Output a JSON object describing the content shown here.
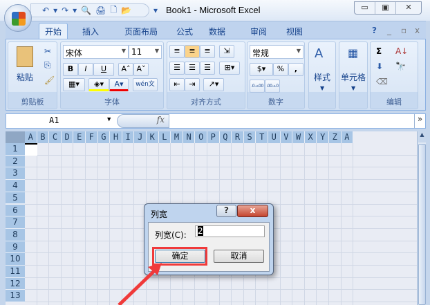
{
  "window": {
    "title": "Book1 - Microsoft Excel",
    "controls": [
      "▭",
      "▣",
      "✕"
    ]
  },
  "qat": {
    "icons": [
      "↶",
      "▾",
      "↷",
      "▾",
      "🔍",
      "🖨",
      "🗋",
      "📂"
    ],
    "customize": "▾"
  },
  "tabs": [
    "开始",
    "插入",
    "页面布局",
    "公式",
    "数据",
    "审阅",
    "视图"
  ],
  "ribbon_right": {
    "help": "?",
    "min": "_",
    "restore": "▫",
    "close": "x"
  },
  "ribbon": {
    "clipboard": {
      "label": "剪贴板",
      "paste": "粘贴"
    },
    "font": {
      "label": "字体",
      "font_name": "宋体",
      "font_size": "11",
      "bold": "B",
      "italic": "I",
      "underline": "U",
      "grow": "A˄",
      "shrink": "A˅",
      "wen": "wén文"
    },
    "alignment": {
      "label": "对齐方式"
    },
    "number": {
      "label": "数字",
      "format": "常规",
      "percent": "%",
      "comma": ",",
      "inc": ".0→.00",
      "dec": ".00→.0"
    },
    "styles": {
      "label": "样式"
    },
    "cells": {
      "label": "单元格"
    },
    "editing": {
      "label": "编辑",
      "sum": "Σ"
    }
  },
  "formula_bar": {
    "name_box": "A1",
    "fx": "fx",
    "value": ""
  },
  "sheet": {
    "columns": [
      "A",
      "B",
      "C",
      "D",
      "E",
      "F",
      "G",
      "H",
      "I",
      "J",
      "K",
      "L",
      "M",
      "N",
      "O",
      "P",
      "Q",
      "R",
      "S",
      "T",
      "U",
      "V",
      "W",
      "X",
      "Y",
      "Z",
      "A"
    ],
    "rows": [
      "1",
      "2",
      "3",
      "4",
      "5",
      "6",
      "7",
      "8",
      "9",
      "10",
      "11",
      "12",
      "13"
    ]
  },
  "dialog": {
    "title": "列宽",
    "help": "?",
    "close": "x",
    "label": "列宽(C):",
    "value": "2",
    "ok": "确定",
    "cancel": "取消"
  },
  "colors": {
    "highlight": "#ff0000",
    "fill": "#ffff00"
  }
}
